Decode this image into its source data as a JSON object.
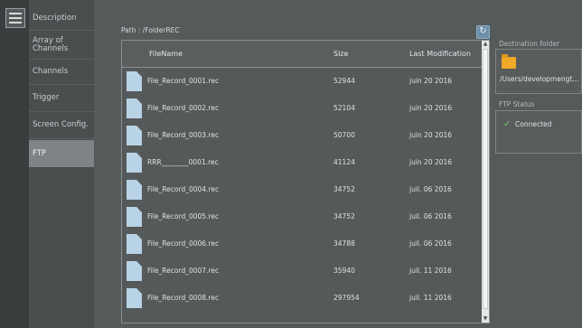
{
  "sidebar": {
    "items": [
      {
        "label": "Description"
      },
      {
        "label": "Array of Channels"
      },
      {
        "label": "Channels"
      },
      {
        "label": "Trigger"
      },
      {
        "label": "Screen Config."
      },
      {
        "label": "FTP"
      }
    ],
    "active": "FTP"
  },
  "path": {
    "text": "Path : /FolderREC"
  },
  "table": {
    "headers": {
      "name": "FileName",
      "size": "Size",
      "modified": "Last Modification"
    },
    "rows": [
      {
        "name": "File_Record_0001.rec",
        "size": "52944",
        "modified": "juin 20 2016"
      },
      {
        "name": "File_Record_0002.rec",
        "size": "52104",
        "modified": "juin 20 2016"
      },
      {
        "name": "File_Record_0003.rec",
        "size": "50700",
        "modified": "juin 20 2016"
      },
      {
        "name": "RRR________0001.rec",
        "size": "41124",
        "modified": "juin 20 2016"
      },
      {
        "name": "File_Record_0004.rec",
        "size": "34752",
        "modified": "juil. 06 2016"
      },
      {
        "name": "File_Record_0005.rec",
        "size": "34752",
        "modified": "juil. 06 2016"
      },
      {
        "name": "File_Record_0006.rec",
        "size": "34788",
        "modified": "juil. 06 2016"
      },
      {
        "name": "File_Record_0007.rec",
        "size": "35940",
        "modified": "juil. 11 2016"
      },
      {
        "name": "File_Record_0008.rec",
        "size": "297954",
        "modified": "juil. 11 2016"
      }
    ]
  },
  "destination": {
    "title": "Destination folder",
    "path": "/Users/developmengt..."
  },
  "ftp": {
    "title": "FTP Status",
    "status": "Connected"
  },
  "colors": {
    "accent": "#6e8fa8",
    "file_icon": "#b9d3e6",
    "folder": "#f0a928",
    "connected": "#79c26b",
    "active_tab": "#7e8486"
  }
}
